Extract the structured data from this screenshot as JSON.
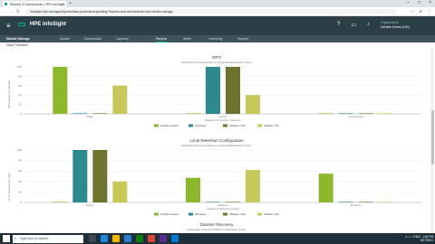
{
  "browser": {
    "tab_title": "Reports & Dashboards | HPE InfoSight",
    "tab_close": "×",
    "new_tab": "+",
    "address": "infosight.hpe.com/app/reports/data-protection/reporting/?reports-and-dashboards=hpe-nimble-storage",
    "window_controls": [
      "–",
      "□",
      "×"
    ]
  },
  "app": {
    "title": "HPE InfoSight",
    "org_label": "Organization",
    "org_value": "Nimble Demo (US)"
  },
  "subnav": {
    "items": [
      "Nimble Storage",
      "Assets",
      "Dashboards",
      "Capacity",
      "Reports",
      "Alerts",
      "Licensing",
      "Support"
    ],
    "active_index": 4
  },
  "breadcrumb": "Data Protection",
  "colors": {
    "series": [
      "#8cb82c",
      "#2c8a8f",
      "#6e7330",
      "#c6c95a"
    ],
    "header": "#2c3e46",
    "accent": "#01a982"
  },
  "chart_data": [
    {
      "type": "bar",
      "title": "RPO",
      "subtitle": "Replicated Protected Data by Snapshot/Replication Policy",
      "ylabel": "Percentage of Volumes",
      "xlabel": "Snapshot Protection Category",
      "categories": [
        "Daily",
        "Hourly",
        "Unprotected"
      ],
      "ylim": [
        0,
        100
      ],
      "yticks": [
        0,
        20,
        40,
        60,
        80,
        100
      ],
      "series": [
        {
          "name": "Nimble Hosted",
          "values": [
            100,
            0,
            0
          ]
        },
        {
          "name": "Windows",
          "values": [
            0,
            100,
            0
          ]
        },
        {
          "name": "VMware VVol",
          "values": [
            0,
            100,
            0
          ]
        },
        {
          "name": "VMware VM",
          "values": [
            60,
            40,
            0
          ]
        }
      ]
    },
    {
      "type": "bar",
      "title": "Local Retention Configuration",
      "subtitle": "Replicated Protected Data by Snapshot/Replication Policy",
      "ylabel": "% of Volumes per Type",
      "xlabel": "Snapshot Retention Period",
      "categories": [
        "Day(s)",
        "Week(s)",
        "Month(s)"
      ],
      "ylim": [
        0,
        100
      ],
      "yticks": [
        0,
        20,
        40,
        60,
        80,
        100
      ],
      "series": [
        {
          "name": "Nimble Hosted",
          "values": [
            0,
            47,
            55
          ]
        },
        {
          "name": "Windows",
          "values": [
            100,
            0,
            0
          ]
        },
        {
          "name": "VMware VVol",
          "values": [
            100,
            0,
            0
          ]
        },
        {
          "name": "VMware VM",
          "values": [
            40,
            62,
            0
          ]
        }
      ]
    }
  ],
  "disaster_recovery": {
    "title": "Disaster Recovery",
    "subtitle": "Replication Protected Data by Replication Policy"
  },
  "taskbar": {
    "search_placeholder": "Type here to search",
    "tray": "∧  ⌂  ♪  ENG",
    "time": "1:46 PM",
    "date": "5/27/2021"
  }
}
